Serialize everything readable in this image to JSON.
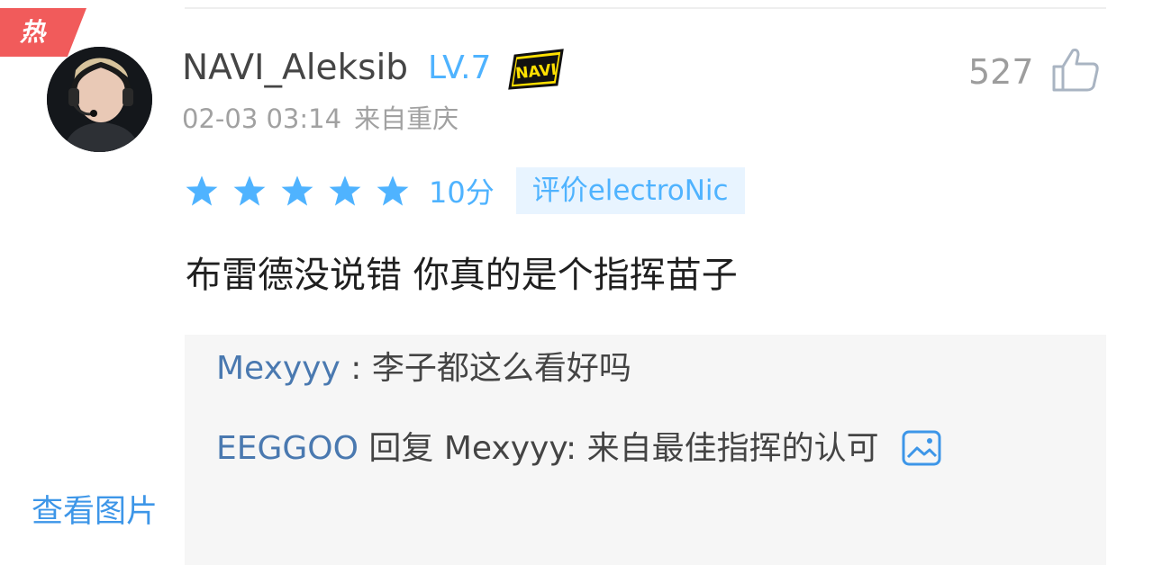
{
  "badge": {
    "label": "热"
  },
  "comment": {
    "username": "NAVI_Aleksib",
    "level": "LV.7",
    "team_logo_icon": "navi-logo",
    "date": "02-03 03:14",
    "location": "来自重庆",
    "likes": "527",
    "rating": {
      "stars": 5,
      "max_stars": 5,
      "score_label": "10分",
      "tag": "评价electroNic"
    },
    "text": "布雷德没说错 你真的是个指挥苗子"
  },
  "replies": [
    {
      "user": "Mexyyy",
      "separator": " : ",
      "text": "李子都这么看好吗"
    },
    {
      "user": "EEGGOO",
      "action": " 回复 ",
      "target": "Mexyyy:",
      "text": " 来自最佳指挥的认可",
      "icon": "image-icon"
    }
  ],
  "view_image_label": "查看图片",
  "colors": {
    "accent": "#4fb3ff",
    "hot_badge": "#f15b5b",
    "reply_user": "#4a79b0",
    "link": "#3d96e8"
  }
}
